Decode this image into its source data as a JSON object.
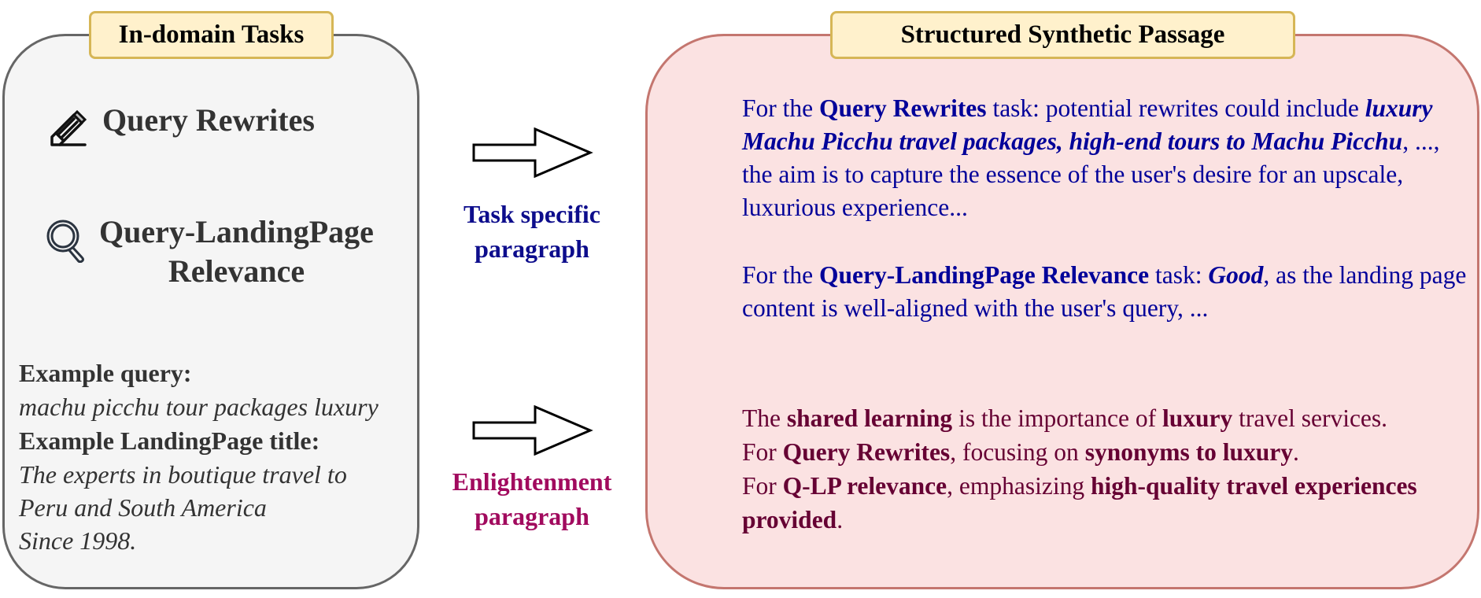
{
  "left_panel": {
    "title": "In-domain Tasks",
    "tasks": [
      {
        "icon": "pencil-icon",
        "label": "Query Rewrites"
      },
      {
        "icon": "search-icon",
        "label_line1": "Query-LandingPage",
        "label_line2": "Relevance"
      }
    ],
    "example_query_label": "Example query:",
    "example_query_value": "machu picchu tour packages luxury",
    "example_title_label": "Example LandingPage title:",
    "example_title_lines": [
      "The experts in boutique travel to",
      "Peru and South America",
      "Since 1998."
    ]
  },
  "arrows": [
    {
      "label_line1": "Task specific",
      "label_line2": "paragraph",
      "color": "#0d0d8c"
    },
    {
      "label_line1": "Enlightenment",
      "label_line2": "paragraph",
      "color": "#a10a5e"
    }
  ],
  "right_panel": {
    "title": "Structured Synthetic Passage",
    "task_paragraph_1": {
      "p1": "For the ",
      "b1": "Query Rewrites",
      "p2": " task: potential rewrites could include ",
      "bi1": "luxury Machu Picchu travel packages, high-end tours to Machu Picchu",
      "p3": ", ..., the aim is to capture the essence of the user's desire for an upscale, luxurious experience..."
    },
    "task_paragraph_2": {
      "p1": "For the ",
      "b1": "Query-LandingPage Relevance",
      "p2": " task: ",
      "bi1": "Good",
      "p3": ", as the landing page content is well-aligned with the user's query, ..."
    },
    "enlightenment_paragraph": {
      "s1_p1": "The ",
      "s1_b1": "shared learning",
      "s1_p2": " is the importance of ",
      "s1_b2": "luxury",
      "s1_p3": " travel services.",
      "s2_p1": "For ",
      "s2_b1": "Query Rewrites",
      "s2_p2": ", focusing on ",
      "s2_b2": "synonyms to luxury",
      "s2_p3": ".",
      "s3_p1": "For ",
      "s3_b1": "Q-LP relevance",
      "s3_p2": ", emphasizing ",
      "s3_b2": "high-quality travel experiences provided",
      "s3_p3": "."
    }
  },
  "colors": {
    "left_fill": "#f5f5f5",
    "left_border": "#666666",
    "right_fill": "#fbe2e2",
    "right_border": "#c4766f",
    "tag_fill": "#fff1cc",
    "tag_border": "#d6b656",
    "task_text": "#000099",
    "enlightenment_text": "#660033"
  }
}
